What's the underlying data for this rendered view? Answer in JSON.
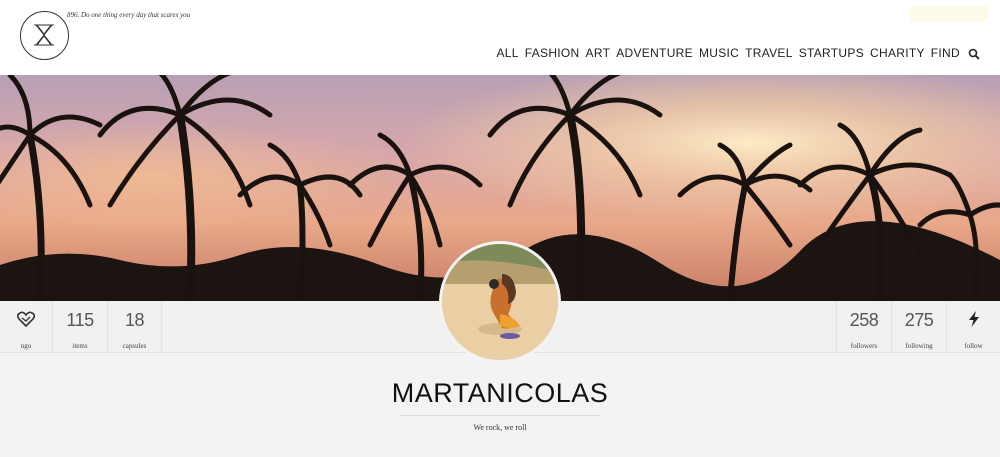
{
  "header": {
    "logo_icon": "hourglass-circle-logo",
    "tagline": "896. Do one thing every day that scares you",
    "nav": [
      "ALL",
      "FASHION",
      "ART",
      "ADVENTURE",
      "MUSIC",
      "TRAVEL",
      "STARTUPS",
      "CHARITY",
      "FIND"
    ],
    "search_icon": "search-icon"
  },
  "cover": {
    "description_icon": "palm-trees-sunset-cover"
  },
  "stats_left": [
    {
      "value": "",
      "label": "ngo",
      "icon": "handshake-heart-icon"
    },
    {
      "value": "115",
      "label": "items"
    },
    {
      "value": "18",
      "label": "capsules"
    }
  ],
  "stats_right": [
    {
      "value": "258",
      "label": "followers"
    },
    {
      "value": "275",
      "label": "following"
    },
    {
      "value": "",
      "label": "follow",
      "icon": "lightning-bolt-icon"
    }
  ],
  "profile": {
    "username": "MARTANICOLAS",
    "bio": "We rock, we roll"
  },
  "colors": {
    "header_bg": "#ffffff",
    "page_bg": "#f3f3f3",
    "text": "#222222",
    "sky_top": "#c9a0a8",
    "sky_glow": "#f4c89a"
  }
}
